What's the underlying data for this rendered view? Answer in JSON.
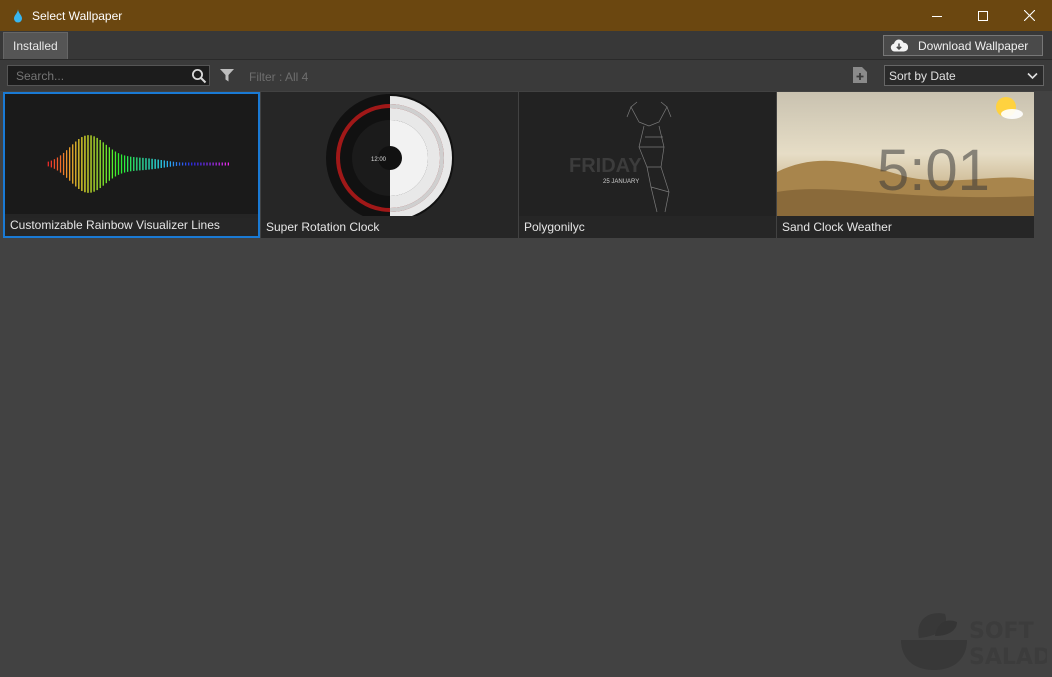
{
  "window": {
    "title": "Select Wallpaper"
  },
  "tabs": [
    {
      "label": "Installed"
    }
  ],
  "toolbar": {
    "download_label": "Download Wallpaper",
    "search_placeholder": "Search...",
    "filter_text": "Filter : All 4",
    "sort_label": "Sort by Date"
  },
  "wallpapers": [
    {
      "title": "Customizable Rainbow Visualizer Lines",
      "selected": true
    },
    {
      "title": "Super Rotation Clock",
      "selected": false
    },
    {
      "title": "Polygonilyc",
      "selected": false
    },
    {
      "title": "Sand Clock Weather",
      "selected": false
    }
  ],
  "previews": {
    "clock_center": "12:00",
    "friday_text": "FRIDAY",
    "friday_date": "25 JANUARY",
    "sand_time": "5:01"
  },
  "watermark": {
    "line1": "SOFT",
    "line2": "SALAD"
  },
  "colors": {
    "titlebar": "#6b4710",
    "selection": "#1a7ad4",
    "background": "#424242"
  }
}
